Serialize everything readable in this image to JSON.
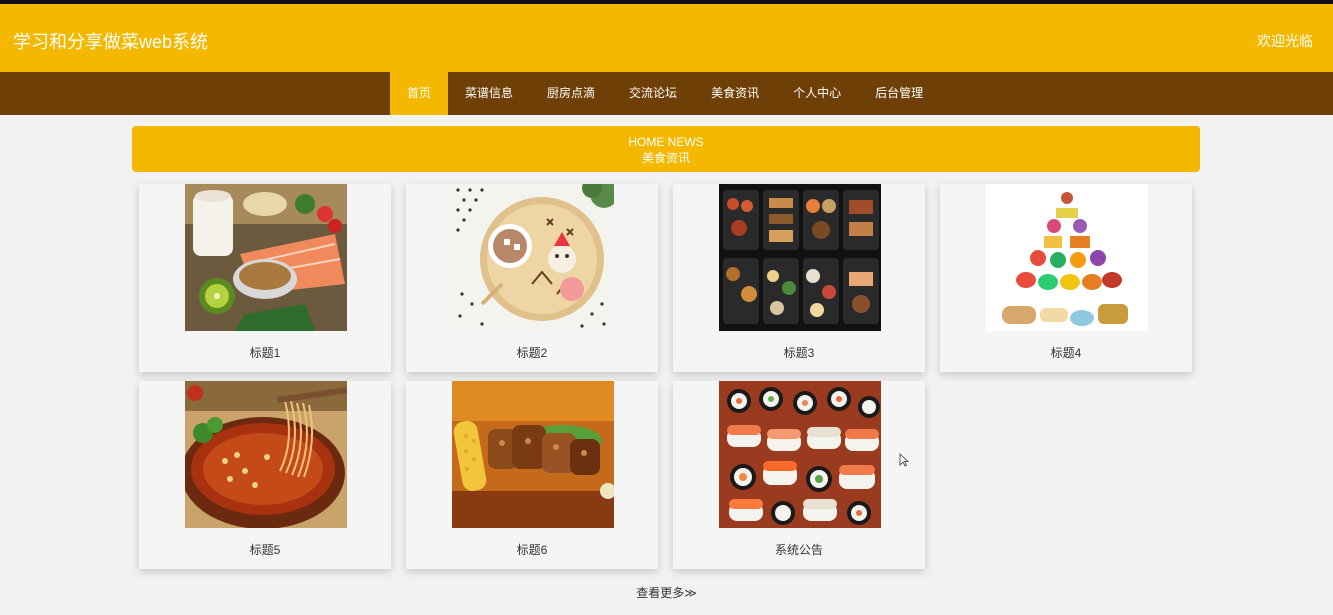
{
  "header": {
    "site_title": "学习和分享做菜web系统",
    "welcome": "欢迎光临"
  },
  "nav": {
    "items": [
      {
        "label": "首页",
        "active": true
      },
      {
        "label": "菜谱信息",
        "active": false
      },
      {
        "label": "厨房点滴",
        "active": false
      },
      {
        "label": "交流论坛",
        "active": false
      },
      {
        "label": "美食资讯",
        "active": false
      },
      {
        "label": "个人中心",
        "active": false
      },
      {
        "label": "后台管理",
        "active": false
      }
    ]
  },
  "section": {
    "title_en": "HOME NEWS",
    "title_cn": "美食资讯"
  },
  "cards": [
    {
      "title": "标题1",
      "image": "healthy-ingredients-salmon-photo"
    },
    {
      "title": "标题2",
      "image": "cocoa-and-cookies-tray-photo"
    },
    {
      "title": "标题3",
      "image": "bento-boxes-photo"
    },
    {
      "title": "标题4",
      "image": "food-pyramid-illustration"
    },
    {
      "title": "标题5",
      "image": "spicy-noodles-bowl-photo"
    },
    {
      "title": "标题6",
      "image": "grilled-chicken-corn-photo"
    },
    {
      "title": "系统公告",
      "image": "sushi-platter-photo"
    }
  ],
  "more_link": "查看更多≫",
  "colors": {
    "accent": "#f4b800",
    "nav_bg": "#6e3f07",
    "page_bg": "#f2f2f2"
  }
}
